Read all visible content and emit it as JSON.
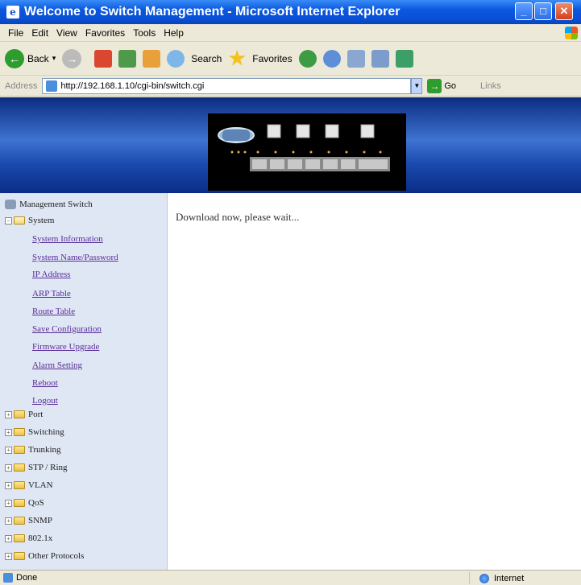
{
  "window": {
    "title": "Welcome to Switch Management - Microsoft Internet Explorer"
  },
  "menu": [
    "File",
    "Edit",
    "View",
    "Favorites",
    "Tools",
    "Help"
  ],
  "toolbar": {
    "back_label": "Back",
    "search_label": "Search",
    "favorites_label": "Favorites"
  },
  "address": {
    "label": "Address",
    "url": "http://192.168.1.10/cgi-bin/switch.cgi",
    "go_label": "Go",
    "links_label": "Links"
  },
  "tree": {
    "root": "Management Switch",
    "system": {
      "label": "System",
      "items": [
        "System Information",
        "System Name/Password",
        "IP Address",
        "ARP Table",
        "Route Table",
        "Save Configuration",
        "Firmware Upgrade",
        "Alarm Setting",
        "Reboot",
        "Logout"
      ]
    },
    "folders": [
      "Port",
      "Switching",
      "Trunking",
      "STP / Ring",
      "VLAN",
      "QoS",
      "SNMP",
      "802.1x",
      "Other Protocols"
    ]
  },
  "main": {
    "message": "Download now, please wait..."
  },
  "status": {
    "text": "Done",
    "zone": "Internet"
  },
  "colors": {
    "title_bar": "#0a58df",
    "tree_bg": "#dfe6f4",
    "link": "#5a2e9a",
    "banner": "#1a49ae"
  }
}
